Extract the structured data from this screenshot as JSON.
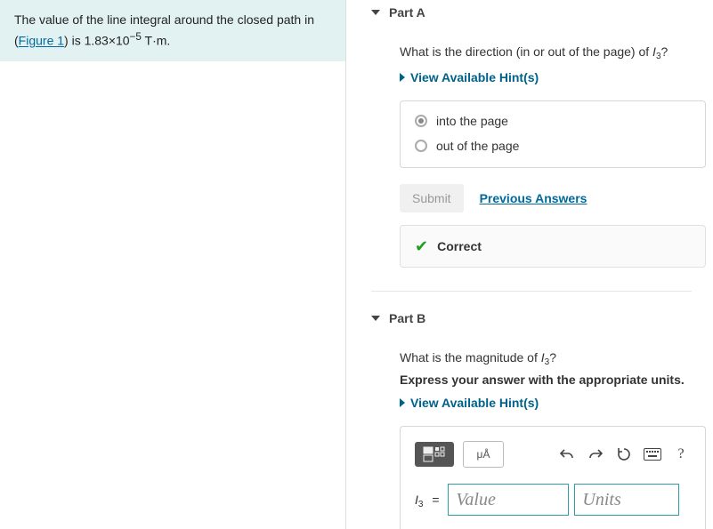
{
  "prompt": {
    "pre_text": "The value of the line integral around the closed path in (",
    "link_text": "Figure 1",
    "post_text": ") is 1.83×10",
    "exp": "−5",
    "units": " T·m."
  },
  "partA": {
    "label": "Part A",
    "question_pre": "What is the direction (in or out of the page) of ",
    "var": "I",
    "sub": "3",
    "question_post": "?",
    "hints_label": "View Available Hint(s)",
    "options": [
      "into the page",
      "out of the page"
    ],
    "selected_index": 0,
    "submit_label": "Submit",
    "prev_label": "Previous Answers",
    "feedback": "Correct"
  },
  "partB": {
    "label": "Part B",
    "question_pre": "What is the magnitude of ",
    "var": "I",
    "sub": "3",
    "question_post": "?",
    "instruct": "Express your answer with the appropriate units.",
    "hints_label": "View Available Hint(s)",
    "toolbar": {
      "special": "μÅ"
    },
    "eq_var": "I",
    "eq_sub": "3",
    "value_placeholder": "Value",
    "units_placeholder": "Units"
  }
}
